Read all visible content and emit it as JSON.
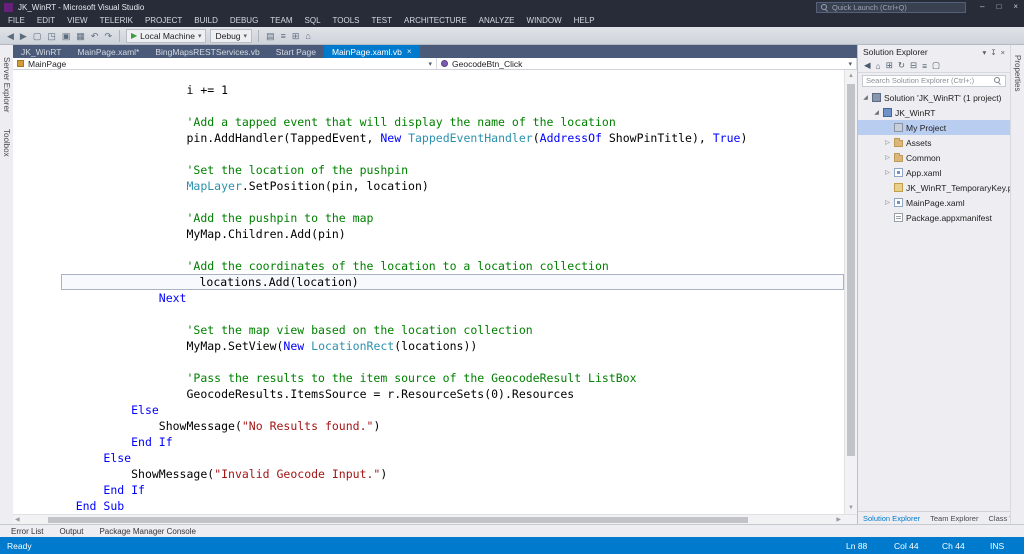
{
  "chrome": {
    "accent": "#007acc",
    "selection": "#b9cdf1"
  },
  "window": {
    "title": "JK_WinRT - Microsoft Visual Studio",
    "quick_launch_placeholder": "Quick Launch (Ctrl+Q)",
    "controls": [
      "minimize-icon",
      "restore-icon",
      "close-icon"
    ]
  },
  "menu_items": [
    "FILE",
    "EDIT",
    "VIEW",
    "TELERIK",
    "PROJECT",
    "BUILD",
    "DEBUG",
    "TEAM",
    "SQL",
    "TOOLS",
    "TEST",
    "ARCHITECTURE",
    "ANALYZE",
    "WINDOW",
    "HELP"
  ],
  "toolbar": {
    "left_icons": [
      "back-icon",
      "forward-icon",
      "new-file-icon",
      "open-file-icon",
      "save-icon",
      "save-all-icon",
      "undo-icon",
      "redo-icon"
    ],
    "run_icon": "start-debug-icon",
    "run_target": "Local Machine",
    "configuration": "Debug",
    "right_icons": [
      "solution-explorer-icon",
      "properties-window-icon",
      "toolbox-icon",
      "start-page-icon"
    ]
  },
  "left_dock_tabs": [
    "Server Explorer",
    "Toolbox"
  ],
  "document_tabs": [
    {
      "label": "JK_WinRT",
      "active": false
    },
    {
      "label": "MainPage.xaml*",
      "active": false
    },
    {
      "label": "BingMapsRESTServices.vb",
      "active": false
    },
    {
      "label": "Start Page",
      "active": false
    },
    {
      "label": "MainPage.xaml.vb",
      "active": true
    }
  ],
  "navbar": {
    "types_dropdown": "MainPage",
    "members_dropdown": "GeocodeBtn_Click"
  },
  "editor": {
    "colors": {
      "keyword": "#0000ff",
      "type": "#2b91af",
      "comment": "#008000",
      "string": "#a31515",
      "plain": "#000000"
    },
    "lines": [
      {
        "indent": 20,
        "segments": [
          [
            "i += 1",
            "pln"
          ]
        ]
      },
      {
        "indent": 0,
        "segments": []
      },
      {
        "indent": 20,
        "segments": [
          [
            "'Add a tapped event that will display the name of the location",
            "com"
          ]
        ]
      },
      {
        "indent": 20,
        "segments": [
          [
            "pin.AddHandler(TappedEvent, ",
            "pln"
          ],
          [
            "New",
            "kw"
          ],
          [
            " ",
            "pln"
          ],
          [
            "TappedEventHandler",
            "typ"
          ],
          [
            "(",
            "pln"
          ],
          [
            "AddressOf",
            "kw"
          ],
          [
            " ShowPinTitle), ",
            "pln"
          ],
          [
            "True",
            "kw"
          ],
          [
            ")",
            "pln"
          ]
        ]
      },
      {
        "indent": 0,
        "segments": []
      },
      {
        "indent": 20,
        "segments": [
          [
            "'Set the location of the pushpin",
            "com"
          ]
        ]
      },
      {
        "indent": 20,
        "segments": [
          [
            "MapLayer",
            "typ"
          ],
          [
            ".SetPosition(pin, location)",
            "pln"
          ]
        ]
      },
      {
        "indent": 0,
        "segments": []
      },
      {
        "indent": 20,
        "segments": [
          [
            "'Add the pushpin to the map",
            "com"
          ]
        ]
      },
      {
        "indent": 20,
        "segments": [
          [
            "MyMap.Children.Add(pin)",
            "pln"
          ]
        ]
      },
      {
        "indent": 0,
        "segments": []
      },
      {
        "indent": 20,
        "segments": [
          [
            "'Add the coordinates of the location to a location collection",
            "com"
          ]
        ]
      },
      {
        "indent": 20,
        "highlight": true,
        "segments": [
          [
            "locations.Add(location)",
            "pln"
          ]
        ]
      },
      {
        "indent": 16,
        "segments": [
          [
            "Next",
            "kw"
          ]
        ]
      },
      {
        "indent": 0,
        "segments": []
      },
      {
        "indent": 20,
        "segments": [
          [
            "'Set the map view based on the location collection",
            "com"
          ]
        ]
      },
      {
        "indent": 20,
        "segments": [
          [
            "MyMap.SetView(",
            "pln"
          ],
          [
            "New",
            "kw"
          ],
          [
            " ",
            "pln"
          ],
          [
            "LocationRect",
            "typ"
          ],
          [
            "(locations))",
            "pln"
          ]
        ]
      },
      {
        "indent": 0,
        "segments": []
      },
      {
        "indent": 20,
        "segments": [
          [
            "'Pass the results to the item source of the GeocodeResult ListBox",
            "com"
          ]
        ]
      },
      {
        "indent": 20,
        "segments": [
          [
            "GeocodeResults.ItemsSource = r.ResourceSets(0).Resources",
            "pln"
          ]
        ]
      },
      {
        "indent": 12,
        "segments": [
          [
            "Else",
            "kw"
          ]
        ]
      },
      {
        "indent": 16,
        "segments": [
          [
            "ShowMessage(",
            "pln"
          ],
          [
            "\"No Results found.\"",
            "str"
          ],
          [
            ")",
            "pln"
          ]
        ]
      },
      {
        "indent": 12,
        "segments": [
          [
            "End If",
            "kw"
          ]
        ]
      },
      {
        "indent": 8,
        "segments": [
          [
            "Else",
            "kw"
          ]
        ]
      },
      {
        "indent": 12,
        "segments": [
          [
            "ShowMessage(",
            "pln"
          ],
          [
            "\"Invalid Geocode Input.\"",
            "str"
          ],
          [
            ")",
            "pln"
          ]
        ]
      },
      {
        "indent": 8,
        "segments": [
          [
            "End If",
            "kw"
          ]
        ]
      },
      {
        "indent": 4,
        "segments": [
          [
            "End Sub",
            "kw"
          ]
        ]
      }
    ]
  },
  "solution_explorer": {
    "title": "Solution Explorer",
    "header_icons": [
      "chevron-down-icon",
      "pin-icon",
      "close-icon"
    ],
    "toolbar_icons": [
      "back-icon",
      "home-icon",
      "show-all-files-icon",
      "refresh-icon",
      "collapse-all-icon",
      "properties-icon",
      "preview-icon"
    ],
    "search_placeholder": "Search Solution Explorer (Ctrl+;)",
    "tree": [
      {
        "depth": 0,
        "expand": "expanded",
        "icon": "solution-icon",
        "label": "Solution 'JK_WinRT' (1 project)",
        "selected": false
      },
      {
        "depth": 1,
        "expand": "expanded",
        "icon": "vb-project-icon",
        "label": "JK_WinRT",
        "selected": false
      },
      {
        "depth": 2,
        "expand": "none",
        "icon": "my-project-icon",
        "label": "My Project",
        "selected": true
      },
      {
        "depth": 2,
        "expand": "collapsed",
        "icon": "folder-icon",
        "label": "Assets",
        "selected": false
      },
      {
        "depth": 2,
        "expand": "collapsed",
        "icon": "folder-icon",
        "label": "Common",
        "selected": false
      },
      {
        "depth": 2,
        "expand": "collapsed",
        "icon": "xaml-file-icon",
        "label": "App.xaml",
        "selected": false
      },
      {
        "depth": 2,
        "expand": "none",
        "icon": "certificate-icon",
        "label": "JK_WinRT_TemporaryKey.pfx",
        "selected": false
      },
      {
        "depth": 2,
        "expand": "collapsed",
        "icon": "xaml-file-icon",
        "label": "MainPage.xaml",
        "selected": false
      },
      {
        "depth": 2,
        "expand": "none",
        "icon": "manifest-icon",
        "label": "Package.appxmanifest",
        "selected": false
      }
    ],
    "bottom_tabs": [
      {
        "label": "Solution Explorer",
        "active": true
      },
      {
        "label": "Team Explorer",
        "active": false
      },
      {
        "label": "Class View",
        "active": false
      }
    ]
  },
  "right_dock_tabs": [
    "Properties"
  ],
  "bottom_dock_tabs": [
    "Error List",
    "Output",
    "Package Manager Console"
  ],
  "status_bar": {
    "mode": "Ready",
    "line": "Ln 88",
    "column": "Col 44",
    "character": "Ch 44",
    "insert_mode": "INS"
  }
}
